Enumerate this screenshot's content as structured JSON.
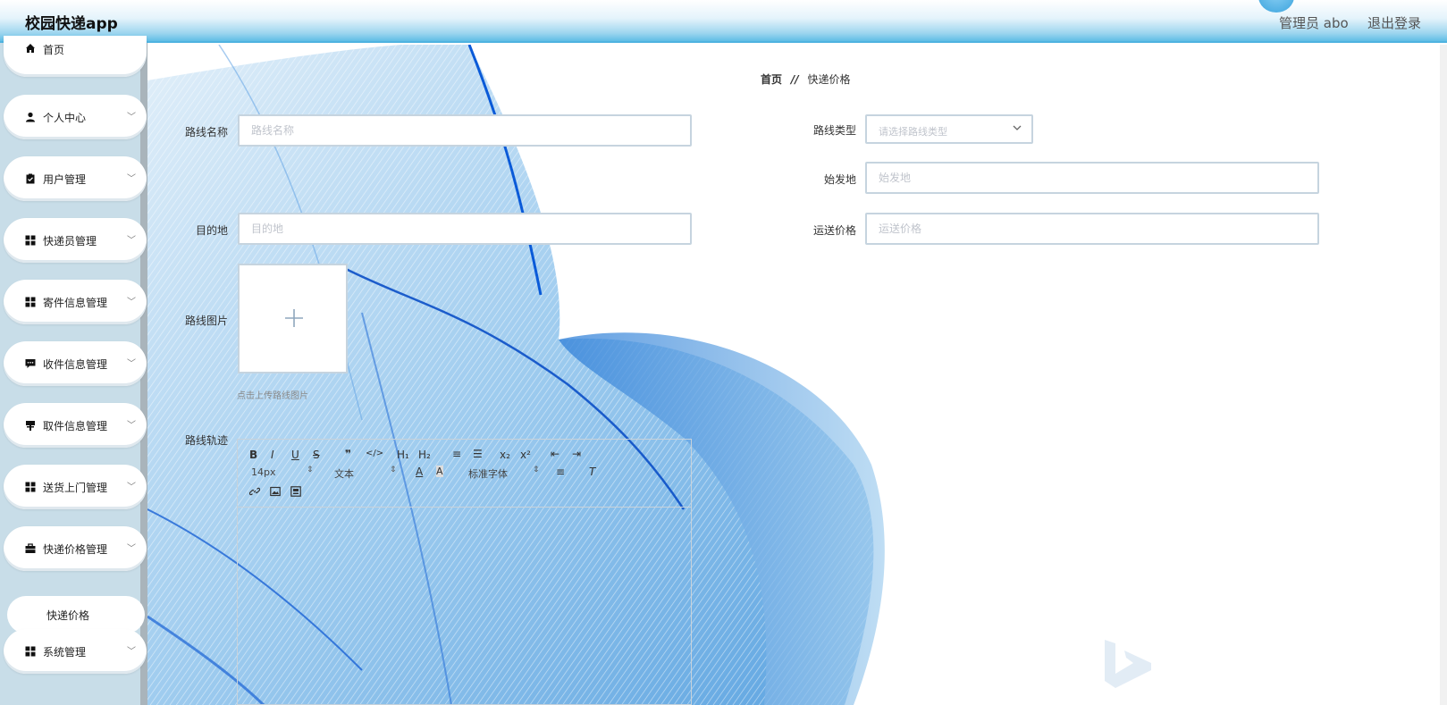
{
  "header": {
    "app_title": "校园快递app",
    "admin_name": "管理员 abo",
    "logout_label": "退出登录"
  },
  "sidebar": {
    "items": [
      {
        "label": "首页",
        "icon": "home-icon",
        "has_children": false
      },
      {
        "label": "个人中心",
        "icon": "user-icon",
        "has_children": true
      },
      {
        "label": "用户管理",
        "icon": "clipboard-icon",
        "has_children": true
      },
      {
        "label": "快递员管理",
        "icon": "grid-icon",
        "has_children": true
      },
      {
        "label": "寄件信息管理",
        "icon": "grid-icon",
        "has_children": true
      },
      {
        "label": "收件信息管理",
        "icon": "message-icon",
        "has_children": true
      },
      {
        "label": "取件信息管理",
        "icon": "signpost-icon",
        "has_children": true
      },
      {
        "label": "送货上门管理",
        "icon": "grid-icon",
        "has_children": true
      },
      {
        "label": "快递价格管理",
        "icon": "briefcase-icon",
        "has_children": true,
        "expanded": true
      },
      {
        "label": "系统管理",
        "icon": "grid-icon",
        "has_children": true
      }
    ],
    "active_subitem": "快递价格"
  },
  "breadcrumb": {
    "home": "首页",
    "separator": "//",
    "current": "快递价格"
  },
  "form": {
    "route_name": {
      "label": "路线名称",
      "placeholder": "路线名称",
      "value": ""
    },
    "route_type": {
      "label": "路线类型",
      "placeholder": "请选择路线类型"
    },
    "origin": {
      "label": "始发地",
      "placeholder": "始发地",
      "value": ""
    },
    "destination": {
      "label": "目的地",
      "placeholder": "目的地",
      "value": ""
    },
    "shipping_price": {
      "label": "运送价格",
      "placeholder": "运送价格",
      "value": ""
    },
    "route_image": {
      "label": "路线图片",
      "hint": "点击上传路线图片"
    },
    "route_track": {
      "label": "路线轨迹"
    }
  },
  "editor": {
    "buttons_row1": [
      "B",
      "I",
      "U",
      "S",
      "❞",
      "</>",
      "H₁",
      "H₂",
      "≡",
      "☰",
      "x₂",
      "x²",
      "⇤",
      "⇥"
    ],
    "font_size": "14px",
    "text_style": "文本",
    "font_family": "标准字体",
    "icons": [
      "bold-icon",
      "italic-icon",
      "underline-icon",
      "strike-icon",
      "quote-icon",
      "code-icon",
      "h1-icon",
      "h2-icon",
      "ordered-list-icon",
      "bullet-list-icon",
      "subscript-icon",
      "superscript-icon",
      "outdent-icon",
      "indent-icon",
      "font-color-icon",
      "background-color-icon",
      "align-icon",
      "clear-format-icon",
      "link-icon",
      "image-icon",
      "video-icon"
    ]
  },
  "colors": {
    "header_gradient_end": "#5fbde6",
    "sidebar_bg": "#c8dde8",
    "wave_blue": "#1a6fe0",
    "input_border": "#c6d4df"
  }
}
